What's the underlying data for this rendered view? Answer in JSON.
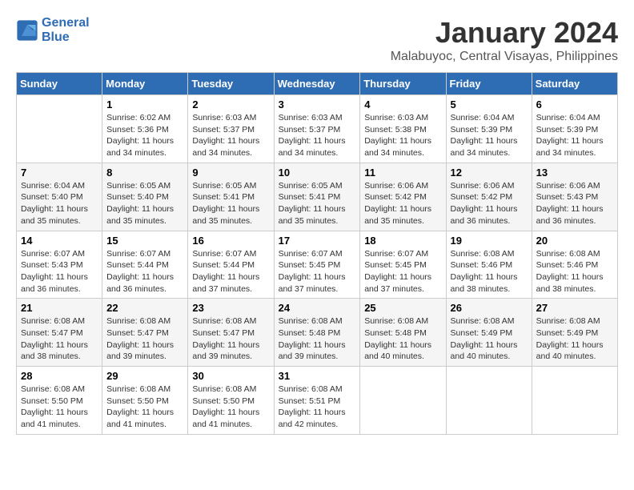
{
  "header": {
    "logo_line1": "General",
    "logo_line2": "Blue",
    "month": "January 2024",
    "location": "Malabuyoc, Central Visayas, Philippines"
  },
  "days_of_week": [
    "Sunday",
    "Monday",
    "Tuesday",
    "Wednesday",
    "Thursday",
    "Friday",
    "Saturday"
  ],
  "weeks": [
    [
      {
        "num": "",
        "info": ""
      },
      {
        "num": "1",
        "info": "Sunrise: 6:02 AM\nSunset: 5:36 PM\nDaylight: 11 hours\nand 34 minutes."
      },
      {
        "num": "2",
        "info": "Sunrise: 6:03 AM\nSunset: 5:37 PM\nDaylight: 11 hours\nand 34 minutes."
      },
      {
        "num": "3",
        "info": "Sunrise: 6:03 AM\nSunset: 5:37 PM\nDaylight: 11 hours\nand 34 minutes."
      },
      {
        "num": "4",
        "info": "Sunrise: 6:03 AM\nSunset: 5:38 PM\nDaylight: 11 hours\nand 34 minutes."
      },
      {
        "num": "5",
        "info": "Sunrise: 6:04 AM\nSunset: 5:39 PM\nDaylight: 11 hours\nand 34 minutes."
      },
      {
        "num": "6",
        "info": "Sunrise: 6:04 AM\nSunset: 5:39 PM\nDaylight: 11 hours\nand 34 minutes."
      }
    ],
    [
      {
        "num": "7",
        "info": "Sunrise: 6:04 AM\nSunset: 5:40 PM\nDaylight: 11 hours\nand 35 minutes."
      },
      {
        "num": "8",
        "info": "Sunrise: 6:05 AM\nSunset: 5:40 PM\nDaylight: 11 hours\nand 35 minutes."
      },
      {
        "num": "9",
        "info": "Sunrise: 6:05 AM\nSunset: 5:41 PM\nDaylight: 11 hours\nand 35 minutes."
      },
      {
        "num": "10",
        "info": "Sunrise: 6:05 AM\nSunset: 5:41 PM\nDaylight: 11 hours\nand 35 minutes."
      },
      {
        "num": "11",
        "info": "Sunrise: 6:06 AM\nSunset: 5:42 PM\nDaylight: 11 hours\nand 35 minutes."
      },
      {
        "num": "12",
        "info": "Sunrise: 6:06 AM\nSunset: 5:42 PM\nDaylight: 11 hours\nand 36 minutes."
      },
      {
        "num": "13",
        "info": "Sunrise: 6:06 AM\nSunset: 5:43 PM\nDaylight: 11 hours\nand 36 minutes."
      }
    ],
    [
      {
        "num": "14",
        "info": "Sunrise: 6:07 AM\nSunset: 5:43 PM\nDaylight: 11 hours\nand 36 minutes."
      },
      {
        "num": "15",
        "info": "Sunrise: 6:07 AM\nSunset: 5:44 PM\nDaylight: 11 hours\nand 36 minutes."
      },
      {
        "num": "16",
        "info": "Sunrise: 6:07 AM\nSunset: 5:44 PM\nDaylight: 11 hours\nand 37 minutes."
      },
      {
        "num": "17",
        "info": "Sunrise: 6:07 AM\nSunset: 5:45 PM\nDaylight: 11 hours\nand 37 minutes."
      },
      {
        "num": "18",
        "info": "Sunrise: 6:07 AM\nSunset: 5:45 PM\nDaylight: 11 hours\nand 37 minutes."
      },
      {
        "num": "19",
        "info": "Sunrise: 6:08 AM\nSunset: 5:46 PM\nDaylight: 11 hours\nand 38 minutes."
      },
      {
        "num": "20",
        "info": "Sunrise: 6:08 AM\nSunset: 5:46 PM\nDaylight: 11 hours\nand 38 minutes."
      }
    ],
    [
      {
        "num": "21",
        "info": "Sunrise: 6:08 AM\nSunset: 5:47 PM\nDaylight: 11 hours\nand 38 minutes."
      },
      {
        "num": "22",
        "info": "Sunrise: 6:08 AM\nSunset: 5:47 PM\nDaylight: 11 hours\nand 39 minutes."
      },
      {
        "num": "23",
        "info": "Sunrise: 6:08 AM\nSunset: 5:47 PM\nDaylight: 11 hours\nand 39 minutes."
      },
      {
        "num": "24",
        "info": "Sunrise: 6:08 AM\nSunset: 5:48 PM\nDaylight: 11 hours\nand 39 minutes."
      },
      {
        "num": "25",
        "info": "Sunrise: 6:08 AM\nSunset: 5:48 PM\nDaylight: 11 hours\nand 40 minutes."
      },
      {
        "num": "26",
        "info": "Sunrise: 6:08 AM\nSunset: 5:49 PM\nDaylight: 11 hours\nand 40 minutes."
      },
      {
        "num": "27",
        "info": "Sunrise: 6:08 AM\nSunset: 5:49 PM\nDaylight: 11 hours\nand 40 minutes."
      }
    ],
    [
      {
        "num": "28",
        "info": "Sunrise: 6:08 AM\nSunset: 5:50 PM\nDaylight: 11 hours\nand 41 minutes."
      },
      {
        "num": "29",
        "info": "Sunrise: 6:08 AM\nSunset: 5:50 PM\nDaylight: 11 hours\nand 41 minutes."
      },
      {
        "num": "30",
        "info": "Sunrise: 6:08 AM\nSunset: 5:50 PM\nDaylight: 11 hours\nand 41 minutes."
      },
      {
        "num": "31",
        "info": "Sunrise: 6:08 AM\nSunset: 5:51 PM\nDaylight: 11 hours\nand 42 minutes."
      },
      {
        "num": "",
        "info": ""
      },
      {
        "num": "",
        "info": ""
      },
      {
        "num": "",
        "info": ""
      }
    ]
  ]
}
